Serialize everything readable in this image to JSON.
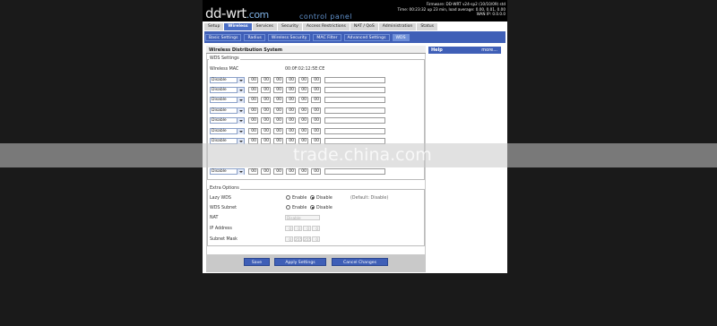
{
  "header": {
    "logo_main": "dd-wrt",
    "logo_suffix": ".com",
    "subtitle": "control panel",
    "info_lines": [
      "Firmware: DD-WRT v24-sp2 (10/10/09) std",
      "Time: 00:23:32 up 23 min, load average: 0.00, 0.01, 0.00",
      "WAN IP: 0.0.0.0"
    ]
  },
  "tabs": [
    "Setup",
    "Wireless",
    "Services",
    "Security",
    "Access Restrictions",
    "NAT / QoS",
    "Administration",
    "Status"
  ],
  "active_tab": "Wireless",
  "subtabs": [
    "Basic Settings",
    "Radius",
    "Wireless Security",
    "MAC Filter",
    "Advanced Settings",
    "WDS"
  ],
  "active_subtab": "WDS",
  "section_title": "Wireless Distribution System",
  "help": {
    "title": "Help",
    "more": "more..."
  },
  "wds": {
    "legend": "WDS Settings",
    "mac_label": "Wireless MAC",
    "mac_value": "00:0F:02:12:5E:CE",
    "rows": [
      {
        "mode": "Disable",
        "octets": [
          "00",
          "00",
          "00",
          "00",
          "00",
          "00"
        ]
      },
      {
        "mode": "Disable",
        "octets": [
          "00",
          "00",
          "00",
          "00",
          "00",
          "00"
        ]
      },
      {
        "mode": "Disable",
        "octets": [
          "00",
          "00",
          "00",
          "00",
          "00",
          "00"
        ]
      },
      {
        "mode": "Disable",
        "octets": [
          "00",
          "00",
          "00",
          "00",
          "00",
          "00"
        ]
      },
      {
        "mode": "Disable",
        "octets": [
          "00",
          "00",
          "00",
          "00",
          "00",
          "00"
        ]
      },
      {
        "mode": "Disable",
        "octets": [
          "00",
          "00",
          "00",
          "00",
          "00",
          "00"
        ]
      },
      {
        "mode": "Disable",
        "octets": [
          "00",
          "00",
          "00",
          "00",
          "00",
          "00"
        ]
      },
      {
        "mode": "Disable",
        "octets": [
          "00",
          "00",
          "00",
          "00",
          "00",
          "00"
        ]
      }
    ]
  },
  "extra": {
    "legend": "Extra Options",
    "lazy_wds_label": "Lazy WDS",
    "wds_subnet_label": "WDS Subnet",
    "nat_label": "NAT",
    "ip_label": "IP Address",
    "mask_label": "Subnet Mask",
    "enable": "Enable",
    "disable": "Disable",
    "default_note": "(Default: Disable)",
    "nat_value": "Disable",
    "ip_octets": [
      "0",
      "0",
      "0",
      "0"
    ],
    "mask_octets": [
      "0",
      "255",
      "255",
      "0"
    ]
  },
  "buttons": {
    "save": "Save",
    "apply": "Apply Settings",
    "cancel": "Cancel Changes"
  },
  "watermark": "trade.china.com"
}
